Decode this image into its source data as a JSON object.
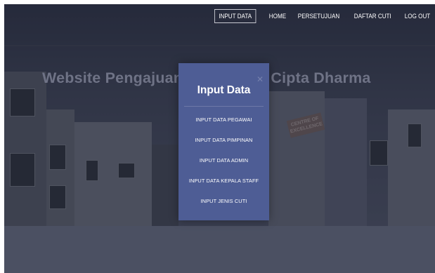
{
  "nav": {
    "items": [
      {
        "label": "INPUT DATA",
        "active": true
      },
      {
        "label": "HOME",
        "active": false
      },
      {
        "label": "PERSETUJUAN",
        "active": false
      },
      {
        "label": "DAFTAR CUTI",
        "active": false
      },
      {
        "label": "LOG OUT",
        "active": false
      }
    ]
  },
  "hero": {
    "title": "Website Pengajuan Cuti Widya Cipta Dharma",
    "sign_text": "CENTRE OF EXCELLENCE"
  },
  "modal": {
    "title": "Input Data",
    "close_icon": "close-icon",
    "links": [
      "INPUT DATA PEGAWAI",
      "INPUT DATA PIMPINAN",
      "INPUT DATA ADMIN",
      "INPUT DATA KEPALA STAFF",
      "INPUT JENIS CUTI"
    ]
  },
  "colors": {
    "modal_bg": "#4e5d95",
    "page_bg": "#474b5f",
    "nav_text": "#ffffff"
  }
}
